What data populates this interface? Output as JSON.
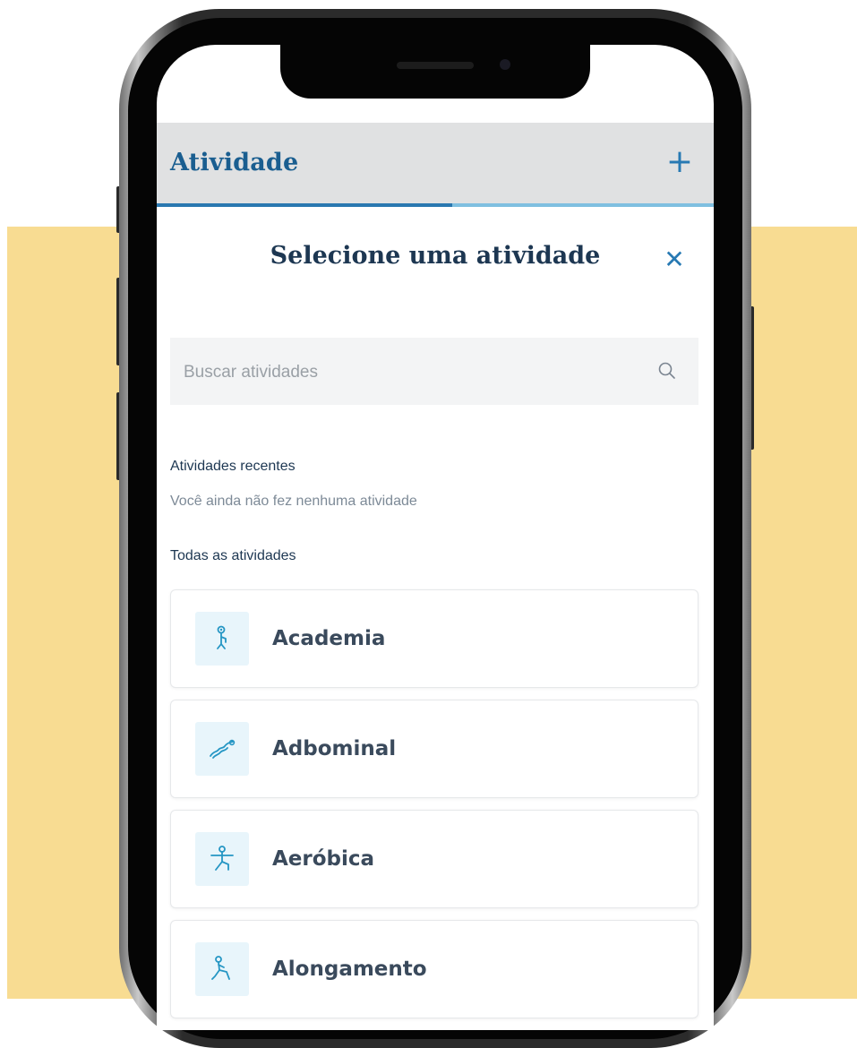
{
  "header": {
    "title": "Atividade",
    "add_icon": "plus-icon",
    "progress": 0.53
  },
  "modal": {
    "title": "Selecione uma atividade",
    "close_icon": "close-icon"
  },
  "search": {
    "placeholder": "Buscar atividades",
    "value": "",
    "icon": "search-icon"
  },
  "recent": {
    "label": "Atividades recentes",
    "empty_text": "Você ainda não fez nenhuma atividade"
  },
  "all": {
    "label": "Todas as atividades",
    "items": [
      {
        "label": "Academia",
        "icon": "gym-icon"
      },
      {
        "label": "Adbominal",
        "icon": "abdominal-icon"
      },
      {
        "label": "Aeróbica",
        "icon": "aerobics-icon"
      },
      {
        "label": "Alongamento",
        "icon": "stretching-icon"
      }
    ]
  },
  "colors": {
    "accent": "#2779b3",
    "title_blue": "#1a5e90",
    "dark_text": "#1d3752",
    "background_band": "#f8dc92",
    "icon_tile": "#e8f5fb"
  }
}
